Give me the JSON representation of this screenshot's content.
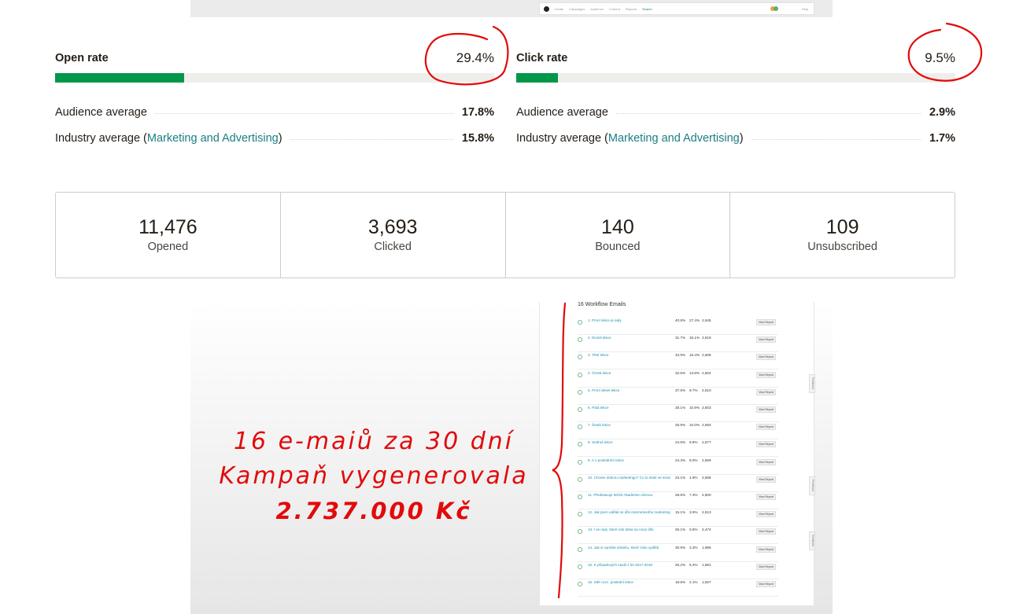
{
  "mini_nav": {
    "items": [
      "Create",
      "Campaigns",
      "Audience",
      "Content",
      "Reports",
      "Search"
    ],
    "active_index": 5,
    "right_text": "Help"
  },
  "open_rate": {
    "label": "Open rate",
    "value": "29.4%",
    "fill_percent": 29.4,
    "audience_label": "Audience average",
    "audience_value": "17.8%",
    "industry_prefix": "Industry average (",
    "industry_link": "Marketing and Advertising",
    "industry_suffix": ")",
    "industry_value": "15.8%"
  },
  "click_rate": {
    "label": "Click rate",
    "value": "9.5%",
    "fill_percent": 9.5,
    "audience_label": "Audience average",
    "audience_value": "2.9%",
    "industry_prefix": "Industry average (",
    "industry_link": "Marketing and Advertising",
    "industry_suffix": ")",
    "industry_value": "1.7%"
  },
  "stats": [
    {
      "value": "11,476",
      "label": "Opened"
    },
    {
      "value": "3,693",
      "label": "Clicked"
    },
    {
      "value": "140",
      "label": "Bounced"
    },
    {
      "value": "109",
      "label": "Unsubscribed"
    }
  ],
  "slogan": {
    "line1": "16 e-maiů za 30 dní",
    "line2": "Kampaň vygenerovala",
    "line3": "2.737.000 Kč"
  },
  "emails_panel": {
    "title": "16 Workflow Emails",
    "button_label": "View Report",
    "feedback_label": "Feedback",
    "emails": [
      {
        "name": "1. První lekce je tady",
        "open": "40.8%",
        "click": "27.4%",
        "sent": "2,645"
      },
      {
        "name": "2. Druhá lekce",
        "open": "31.7%",
        "click": "15.1%",
        "sent": "2,619"
      },
      {
        "name": "3. Třetí lekce",
        "open": "34.9%",
        "click": "15.4%",
        "sent": "2,608"
      },
      {
        "name": "4. Čtvrtá lekce",
        "open": "32.5%",
        "click": "13.8%",
        "sent": "2,602"
      },
      {
        "name": "5. První deset lekce",
        "open": "37.5%",
        "click": "9.7%",
        "sent": "2,610"
      },
      {
        "name": "6. Pátá lekce",
        "open": "28.1%",
        "click": "10.9%",
        "sent": "2,603"
      },
      {
        "name": "7. Šestá lekce",
        "open": "25.9%",
        "click": "10.0%",
        "sent": "2,594"
      },
      {
        "name": "8. Sedmá lekce",
        "open": "24.8%",
        "click": "8.8%",
        "sent": "2,577"
      },
      {
        "name": "9. A o posledním lekce",
        "open": "24.3%",
        "click": "8.0%",
        "sent": "2,569"
      },
      {
        "name": "10. Chcete dobrou marketingu? Co to dusit se teraz?",
        "open": "23.1%",
        "click": "1.9%",
        "sent": "2,558"
      },
      {
        "name": "11. Představuje 50/20 Akademie učenou",
        "open": "28.8%",
        "click": "7.3%",
        "sent": "2,600"
      },
      {
        "name": "12. Jak jsem udělal se dílo internetového marketingu?",
        "open": "15.1%",
        "click": "3.5%",
        "sent": "2,513"
      },
      {
        "name": "13. I ve nejs, které nás deka na nový dílo",
        "open": "25.1%",
        "click": "0.5%",
        "sent": "2,474"
      },
      {
        "name": "14. Jak si vyrobte stránku, které Vám vydělá",
        "open": "30.9%",
        "click": "3.3%",
        "sent": "1,986"
      },
      {
        "name": "15. K případových studii z let 2017-2018",
        "open": "26.2%",
        "click": "5.2%",
        "sent": "1,981"
      },
      {
        "name": "16. Stěr rozc. poslední lekce",
        "open": "18.8%",
        "click": "2.1%",
        "sent": "1,927"
      }
    ]
  },
  "colors": {
    "bar_fill": "#00974a",
    "bar_track": "#efeeea",
    "link": "#1b7d83",
    "annotation_red": "#e20a0a"
  }
}
